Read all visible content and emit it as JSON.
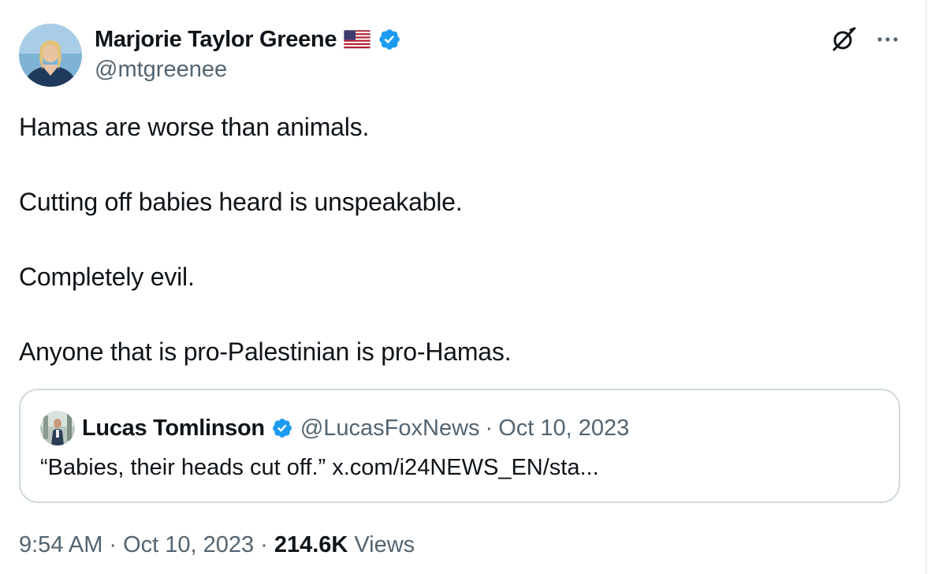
{
  "author": {
    "name": "Marjorie Taylor Greene",
    "handle": "@mtgreenee",
    "flag": "us-flag-icon",
    "verified": true
  },
  "actions": {
    "grok_icon": "grok-icon",
    "more_icon": "more-icon"
  },
  "tweet": {
    "paragraphs": [
      "Hamas are worse than animals.",
      "Cutting off babies heard is unspeakable.",
      "Completely evil.",
      "Anyone that is pro-Palestinian is pro-Hamas."
    ]
  },
  "quote": {
    "author_name": "Lucas Tomlinson",
    "author_handle": "@LucasFoxNews",
    "separator": "·",
    "date": "Oct 10, 2023",
    "text": "“Babies, their heads cut off.” x.com/i24NEWS_EN/sta..."
  },
  "meta": {
    "time": "9:54 AM",
    "separator": "·",
    "date": "Oct 10, 2023",
    "views_count": "214.6K",
    "views_label": "Views"
  },
  "colors": {
    "text": "#0f1419",
    "secondary": "#536471",
    "verified": "#1d9bf0",
    "border": "#cfd9de"
  }
}
